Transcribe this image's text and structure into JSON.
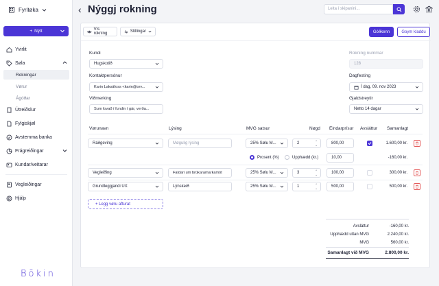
{
  "sidebar": {
    "company": "Fyritøka",
    "new_label": "Nýtt",
    "items": [
      {
        "label": "Yvirlit"
      },
      {
        "label": "Søla"
      },
      {
        "label": "Útreiðslur"
      },
      {
        "label": "Fylgiskjøl"
      },
      {
        "label": "Avstemma banka"
      },
      {
        "label": "Frágreiðingar"
      },
      {
        "label": "Kundar/veitarar"
      },
      {
        "label": "Vegleiðingar"
      },
      {
        "label": "Hjálp"
      }
    ],
    "sub_items": [
      {
        "label": "Rokningar",
        "active": true
      },
      {
        "label": "Vørur"
      },
      {
        "label": "Ágóðar"
      }
    ],
    "logo": "Bōkin"
  },
  "header": {
    "title": "Nýggj rokning",
    "search_placeholder": "Leita í skipanini..."
  },
  "toolbar": {
    "view_label": "Vís rokning",
    "settings_label": "Stillingar",
    "finalize_label": "Góðkenn",
    "save_draft_label": "Goym kladdu"
  },
  "form": {
    "customer_label": "Kundi",
    "customer_value": "Hugskotið",
    "contact_label": "Kontaktpersónur",
    "contact_value": "Karin Laksáfoss <karin@orv...",
    "note_label": "Viðmerking",
    "note_value": "Sum lovað í fundin í gár, verða...",
    "invoice_number_label": "Rokning nummar",
    "invoice_number_value": "128",
    "date_label": "Dagfesting",
    "date_value": "Í dag, 09. nov 2023",
    "terms_label": "Gjaldstreytir",
    "terms_value": "Netto 14 dagar"
  },
  "table": {
    "headers": {
      "product": "Vørunavn",
      "description": "Lýsing",
      "vat": "MVG satsur",
      "qty": "Nøgd",
      "unit_price": "Eindarprísur",
      "discount": "Avsláttur",
      "total": "Samanlagt"
    },
    "rows": [
      {
        "product": "Ráðgeving",
        "description": "Møgulig lýsing",
        "vat": "25% Sølu M...",
        "qty": "2",
        "unit_price": "800,00",
        "total": "1.600,00 kr."
      },
      {
        "product": "Vegleiðing",
        "description": "Faldari um brúkaramarkamót",
        "vat": "25% Sølu M...",
        "qty": "3",
        "unit_price": "100,00",
        "total": "300,00 kr."
      },
      {
        "product": "Grundleggjandi UX",
        "description": "Lýnskeið",
        "vat": "25% Sølu M...",
        "qty": "1",
        "unit_price": "500,00",
        "total": "500,00 kr."
      }
    ],
    "discount_row": {
      "percent_label": "Prosent (%)",
      "amount_label": "Upphædd (kr.)",
      "value": "10,00",
      "total": "-160,00 kr."
    },
    "add_line_label": "+ Legg vøru afturat"
  },
  "summary": {
    "discount_label": "Avsláttur",
    "discount_value": "-160,00 kr.",
    "excl_vat_label": "Upphædd uttan MVG",
    "excl_vat_value": "2.240,00 kr.",
    "vat_label": "MVG",
    "vat_value": "560,00 kr.",
    "total_label": "Samanlagt við MVG",
    "total_value": "2.800,00 kr."
  },
  "colors": {
    "accent": "#4b35d6",
    "danger": "#e45b5b"
  }
}
